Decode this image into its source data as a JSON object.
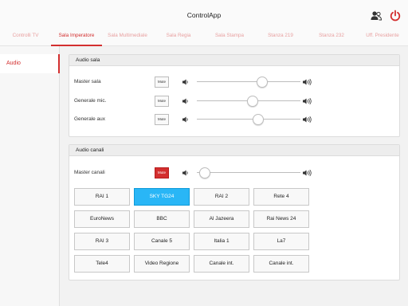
{
  "app": {
    "title": "ControlApp"
  },
  "header": {
    "users_icon": "users-icon",
    "power_icon": "power-icon",
    "accent": "#d32f2f"
  },
  "tabs": [
    {
      "label": "Controlli TV",
      "active": false
    },
    {
      "label": "Sala Imperatore",
      "active": true
    },
    {
      "label": "Sala Multimediale",
      "active": false
    },
    {
      "label": "Sala Regia",
      "active": false
    },
    {
      "label": "Sala Stampa",
      "active": false
    },
    {
      "label": "Stanza 219",
      "active": false
    },
    {
      "label": "Stanza 232",
      "active": false
    },
    {
      "label": "Uff. Presidente",
      "active": false
    }
  ],
  "sidebar": {
    "items": [
      {
        "label": "Audio",
        "active": true
      }
    ]
  },
  "audio_sala": {
    "title": "Audio sala",
    "rows": [
      {
        "label": "Master sala",
        "mute_label": "Mute",
        "muted": false,
        "level": 0.63
      },
      {
        "label": "Generale mic.",
        "mute_label": "Mute",
        "muted": false,
        "level": 0.54
      },
      {
        "label": "Generale aux",
        "mute_label": "Mute",
        "muted": false,
        "level": 0.59
      }
    ]
  },
  "audio_canali": {
    "title": "Audio canali",
    "master": {
      "label": "Master canali",
      "mute_label": "Mute",
      "muted": true,
      "level": 0.08
    },
    "channels": [
      {
        "label": "RAI 1",
        "selected": false
      },
      {
        "label": "SKY TG24",
        "selected": true
      },
      {
        "label": "RAI 2",
        "selected": false
      },
      {
        "label": "Rete 4",
        "selected": false
      },
      {
        "label": "EuroNews",
        "selected": false
      },
      {
        "label": "BBC",
        "selected": false
      },
      {
        "label": "Al Jazeera",
        "selected": false
      },
      {
        "label": "Rai News 24",
        "selected": false
      },
      {
        "label": "RAI 3",
        "selected": false
      },
      {
        "label": "Canale 5",
        "selected": false
      },
      {
        "label": "Italia 1",
        "selected": false
      },
      {
        "label": "La7",
        "selected": false
      },
      {
        "label": "Tele4",
        "selected": false
      },
      {
        "label": "Video Regione",
        "selected": false
      },
      {
        "label": "Canale int.",
        "selected": false
      },
      {
        "label": "Canale int.",
        "selected": false
      }
    ],
    "selected_color": "#29b6f6"
  }
}
